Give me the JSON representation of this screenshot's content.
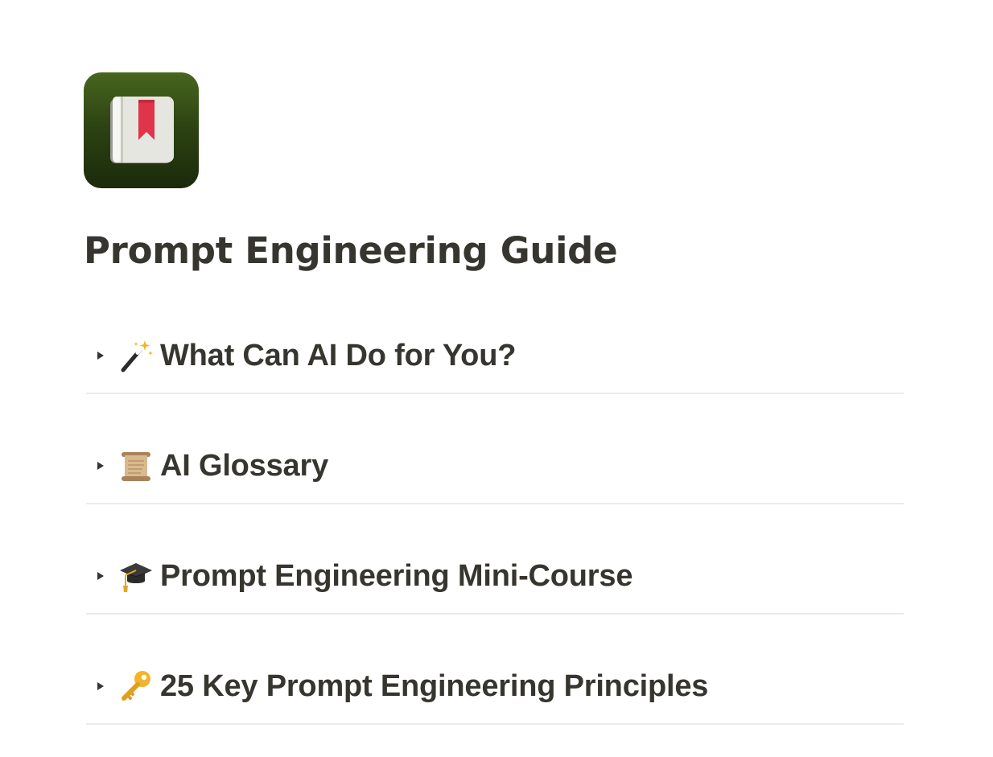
{
  "page": {
    "title": "Prompt Engineering Guide",
    "icon": "green-book-bookmark-icon"
  },
  "toggles": [
    {
      "label": "What Can AI Do for You?",
      "icon": "magic-wand-icon"
    },
    {
      "label": "AI Glossary",
      "icon": "scroll-icon"
    },
    {
      "label": "Prompt Engineering Mini-Course",
      "icon": "graduation-cap-icon"
    },
    {
      "label": "25 Key Prompt Engineering Principles",
      "icon": "key-icon"
    }
  ],
  "colors": {
    "text": "#37352f",
    "divider": "#ebebea",
    "icon_background": "#2c4212",
    "bookmark": "#e0344a"
  }
}
